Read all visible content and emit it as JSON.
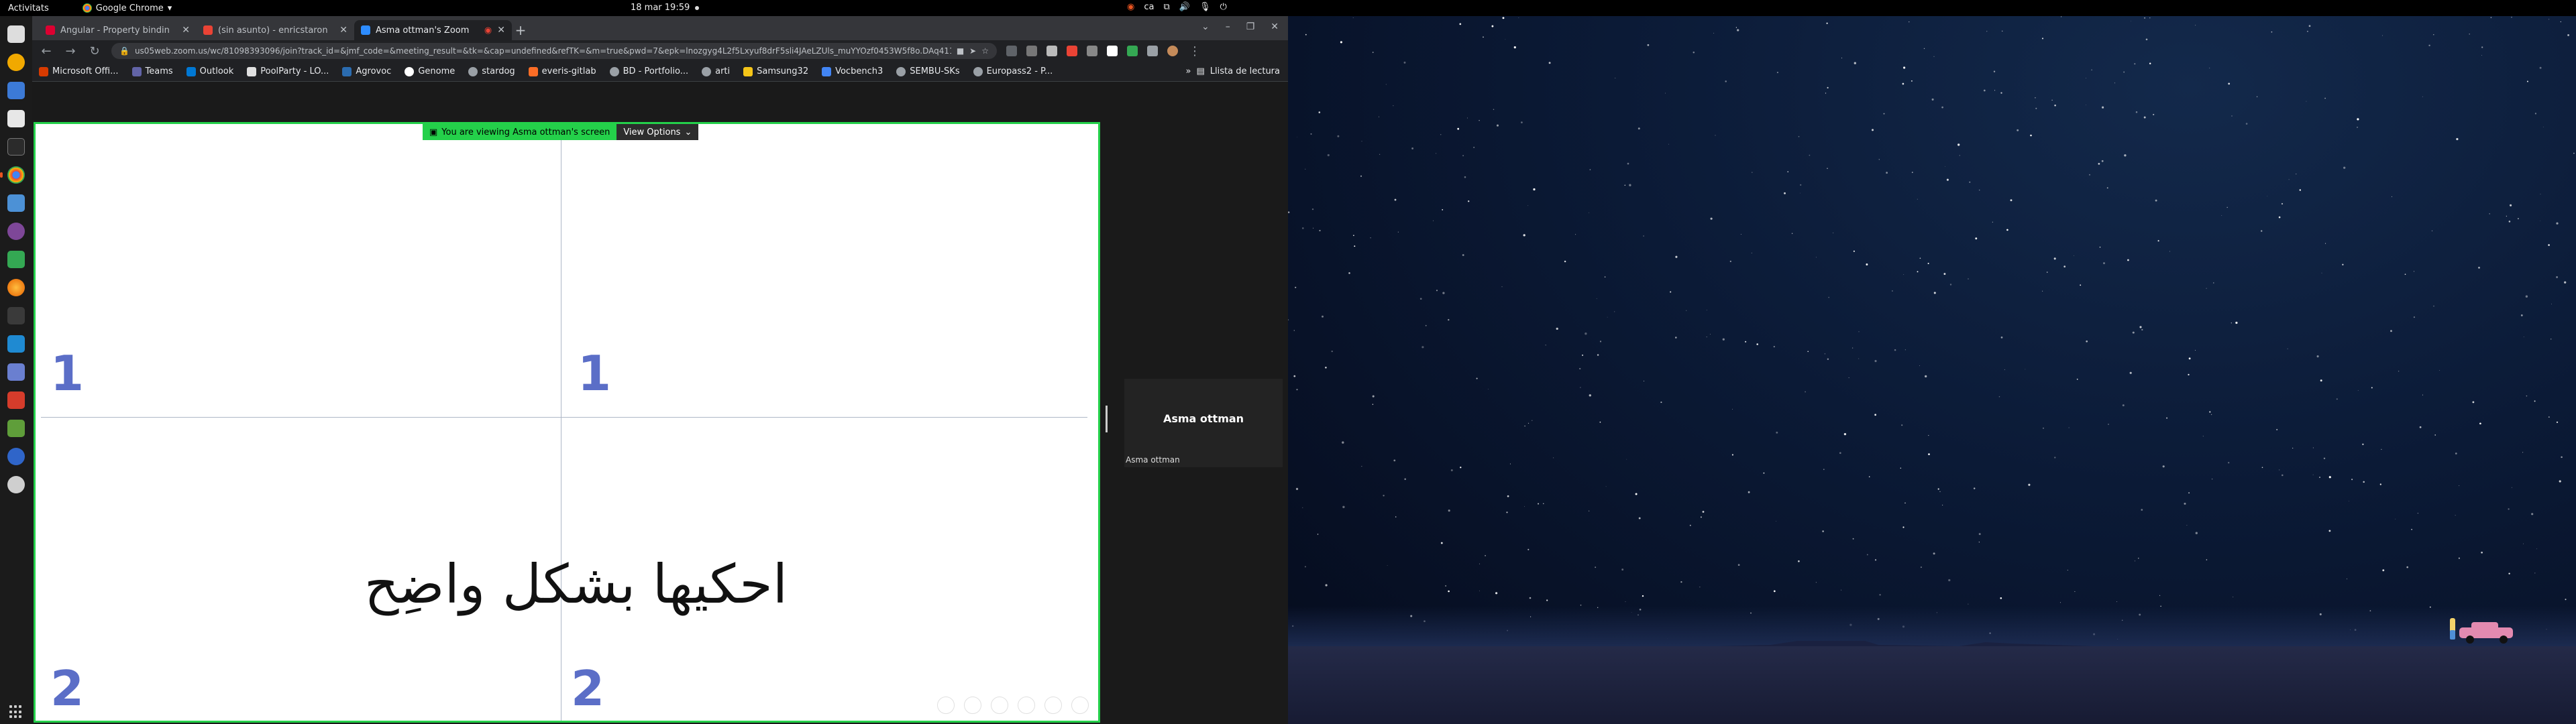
{
  "topbar": {
    "activities": "Activitats",
    "app_name": "Google Chrome",
    "clock": "18 mar  19:59",
    "keyboard_layout": "ca"
  },
  "dock": {
    "items": [
      "files-icon",
      "chromium-icon",
      "text-editor-icon",
      "disk-icon",
      "terminal-icon",
      "chrome-icon",
      "settings-icon",
      "tor-icon",
      "document-icon",
      "firefox-icon",
      "terminal2-icon",
      "vscode-icon",
      "gear-icon",
      "git-icon",
      "editor-icon",
      "virtualbox-icon",
      "disc-icon"
    ]
  },
  "tabs": [
    {
      "title": "Angular - Property bindin",
      "favicon_color": "#dd0031"
    },
    {
      "title": "(sin asunto) - enricstaron",
      "favicon_color": "#ea4335"
    },
    {
      "title": "Asma ottman's Zoom",
      "favicon_color": "#2d8cff",
      "active": true
    }
  ],
  "toolbar": {
    "url": "us05web.zoom.us/wc/81098393096/join?track_id=&jmf_code=&meeting_result=&tk=&cap=undefined&refTK=&m=true&pwd=7&epk=lnozgyg4L2f5Lxyuf8drF5sli4JAeLZUls_muYYOzf0453W5f8o.DAq411M..."
  },
  "bookmarks": [
    {
      "label": "Microsoft Offi...",
      "color": "#d83b01"
    },
    {
      "label": "Teams",
      "color": "#6264a7"
    },
    {
      "label": "Outlook",
      "color": "#0078d4"
    },
    {
      "label": "PoolParty - LO...",
      "color": "#e0e0e0"
    },
    {
      "label": "Agrovoc",
      "color": "#2b6cb0"
    },
    {
      "label": "Genome",
      "color": "#ffffff"
    },
    {
      "label": "stardog",
      "color": "#9aa0a6"
    },
    {
      "label": "everis-gitlab",
      "color": "#fc6d26"
    },
    {
      "label": "BD - Portfolio...",
      "color": "#9aa0a6"
    },
    {
      "label": "arti",
      "color": "#9aa0a6"
    },
    {
      "label": "Samsung32",
      "color": "#f5c518"
    },
    {
      "label": "Vocbench3",
      "color": "#4285f4"
    },
    {
      "label": "SEMBU-SKs",
      "color": "#9aa0a6"
    },
    {
      "label": "Europass2 - P...",
      "color": "#9aa0a6"
    }
  ],
  "reading_list": "Llista de lectura",
  "zoom": {
    "banner_text": "You are viewing Asma ottman's screen",
    "view_options": "View Options",
    "slide": {
      "top_left_number": "1",
      "top_center_number": "1",
      "bottom_left_number": "2",
      "bottom_center_number": "2",
      "arabic_text": "احكيها بشكل واضِح"
    },
    "participant": {
      "name": "Asma ottman",
      "label": "Asma ottman"
    }
  }
}
